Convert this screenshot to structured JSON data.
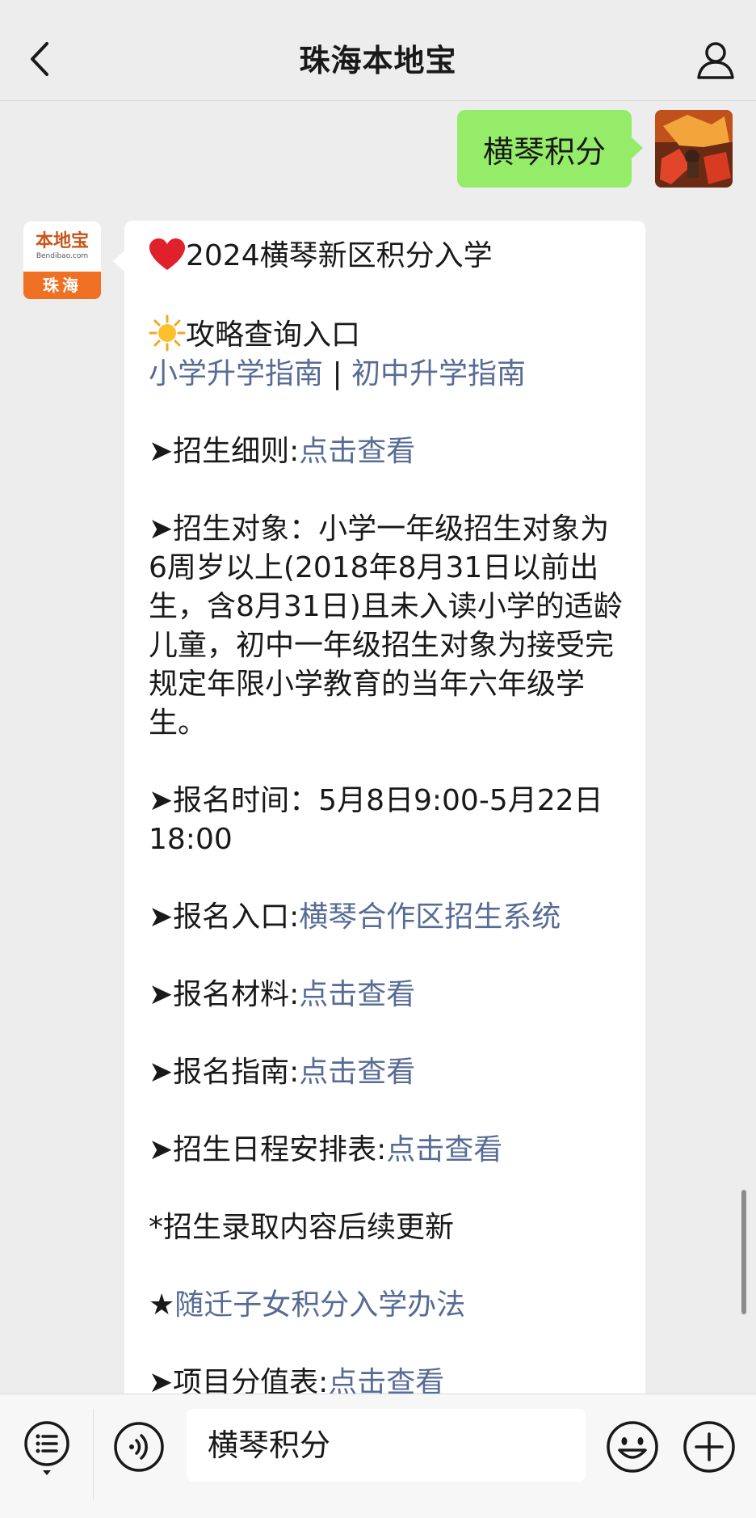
{
  "header": {
    "title": "珠海本地宝"
  },
  "chat": {
    "outgoing_message": "横琴积分",
    "bot_avatar": {
      "logo_text": "本地宝",
      "logo_sub": "Bendibao.com",
      "city": "珠海"
    },
    "incoming": {
      "title_line": "2024横琴新区积分入学",
      "guide_label": "攻略查询入口",
      "guide_link_1": "小学升学指南",
      "guide_sep": " | ",
      "guide_link_2": "初中升学指南",
      "rules_label": "➤招生细则:",
      "rules_link": "点击查看",
      "target_text": "➤招生对象：小学一年级招生对象为6周岁以上(2018年8月31日以前出生，含8月31日)且未入读小学的适龄儿童，初中一年级招生对象为接受完规定年限小学教育的当年六年级学生。",
      "time_text": "➤报名时间：5月8日9:00-5月22日18:00",
      "entry_label": "➤报名入口:",
      "entry_link": "横琴合作区招生系统",
      "materials_label": "➤报名材料:",
      "materials_link": "点击查看",
      "guide2_label": "➤报名指南:",
      "guide2_link": "点击查看",
      "schedule_label": "➤招生日程安排表:",
      "schedule_link": "点击查看",
      "update_note": "*招生录取内容后续更新",
      "policy_star": "★",
      "policy_link": "随迁子女积分入学办法",
      "score_label": "➤项目分值表:",
      "score_link": "点击查看"
    }
  },
  "input": {
    "value": "横琴积分"
  },
  "colors": {
    "link": "#576b95",
    "outgoing_bubble": "#95ec69",
    "background": "#ededed"
  },
  "icons": [
    "back-arrow-icon",
    "profile-icon",
    "heart-icon",
    "sun-icon",
    "menu-list-icon",
    "voice-icon",
    "emoji-icon",
    "plus-icon"
  ]
}
